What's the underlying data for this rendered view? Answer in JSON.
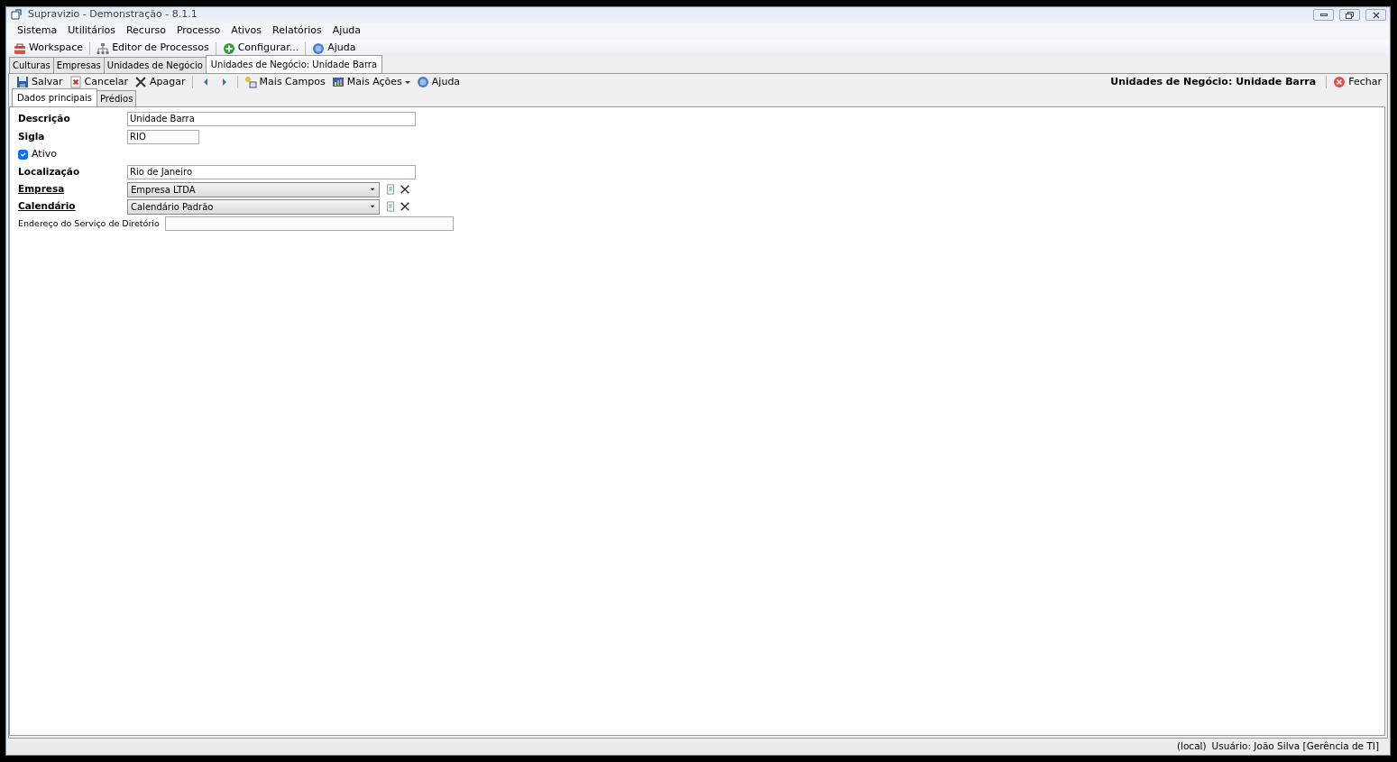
{
  "window": {
    "title": "Supravizio - Demonstração - 8.1.1"
  },
  "menu": [
    "Sistema",
    "Utilitários",
    "Recurso",
    "Processo",
    "Ativos",
    "Relatórios",
    "Ajuda"
  ],
  "toolbar": [
    "Workspace",
    "Editor de Processos",
    "Configurar...",
    "Ajuda"
  ],
  "document_tabs": [
    {
      "label": "Culturas",
      "selected": false
    },
    {
      "label": "Empresas",
      "selected": false
    },
    {
      "label": "Unidades de Negócio",
      "selected": false
    },
    {
      "label": "Unidades de Negócio: Unidade Barra",
      "selected": true
    }
  ],
  "record_toolbar": {
    "actions": [
      "Salvar",
      "Cancelar",
      "Apagar"
    ],
    "more": [
      "Mais Campos",
      "Mais Ações",
      "Ajuda"
    ],
    "heading": "Unidades de Negócio: Unidade Barra",
    "close": "Fechar"
  },
  "form_tabs": [
    {
      "label": "Dados principais",
      "selected": true
    },
    {
      "label": "Prédios",
      "selected": false
    }
  ],
  "fields": [
    {
      "kind": "text",
      "label": "Descrição",
      "value": "Unidade Barra"
    },
    {
      "kind": "short",
      "label": "Sigla",
      "value": "RIO"
    },
    {
      "kind": "checkbox",
      "label": "Ativo",
      "checked": true
    },
    {
      "kind": "text",
      "label": "Localização",
      "value": "Rio de Janeiro"
    },
    {
      "kind": "combo",
      "label": "Empresa",
      "value": "Empresa LTDA"
    },
    {
      "kind": "combo",
      "label": "Calendário",
      "value": "Calendário Padrão"
    },
    {
      "kind": "wide",
      "label": "Endereço do Serviço de Diretório"
    }
  ],
  "status_bar": [
    "(local)",
    "Usuário: João Silva [Gerência de TI]"
  ]
}
